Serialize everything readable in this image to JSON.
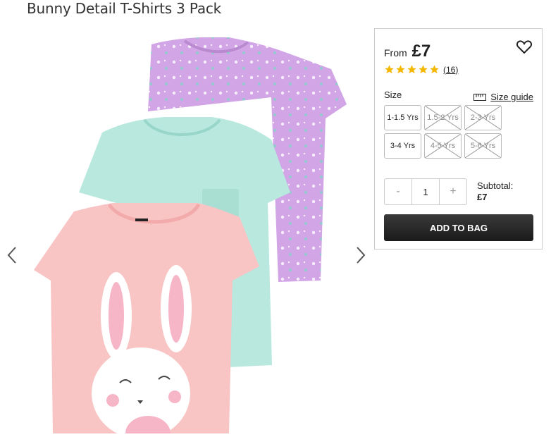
{
  "product": {
    "title": "Bunny Detail T-Shirts 3 Pack",
    "from_label": "From",
    "price": "£7",
    "rating": 5,
    "review_count": "16"
  },
  "size": {
    "label": "Size",
    "guide_label": "Size guide",
    "options": [
      {
        "label": "1-1.5 Yrs",
        "available": true
      },
      {
        "label": "1.5-2 Yrs",
        "available": false
      },
      {
        "label": "2-3 Yrs",
        "available": false
      },
      {
        "label": "3-4 Yrs",
        "available": true
      },
      {
        "label": "4-5 Yrs",
        "available": false
      },
      {
        "label": "5-6 Yrs",
        "available": false
      }
    ]
  },
  "quantity": {
    "minus": "-",
    "value": "1",
    "plus": "+"
  },
  "subtotal": {
    "label": "Subtotal:",
    "value": "£7"
  },
  "actions": {
    "add_to_bag": "ADD TO BAG"
  },
  "colors": {
    "star": "#f5b800",
    "button": "#222222"
  }
}
